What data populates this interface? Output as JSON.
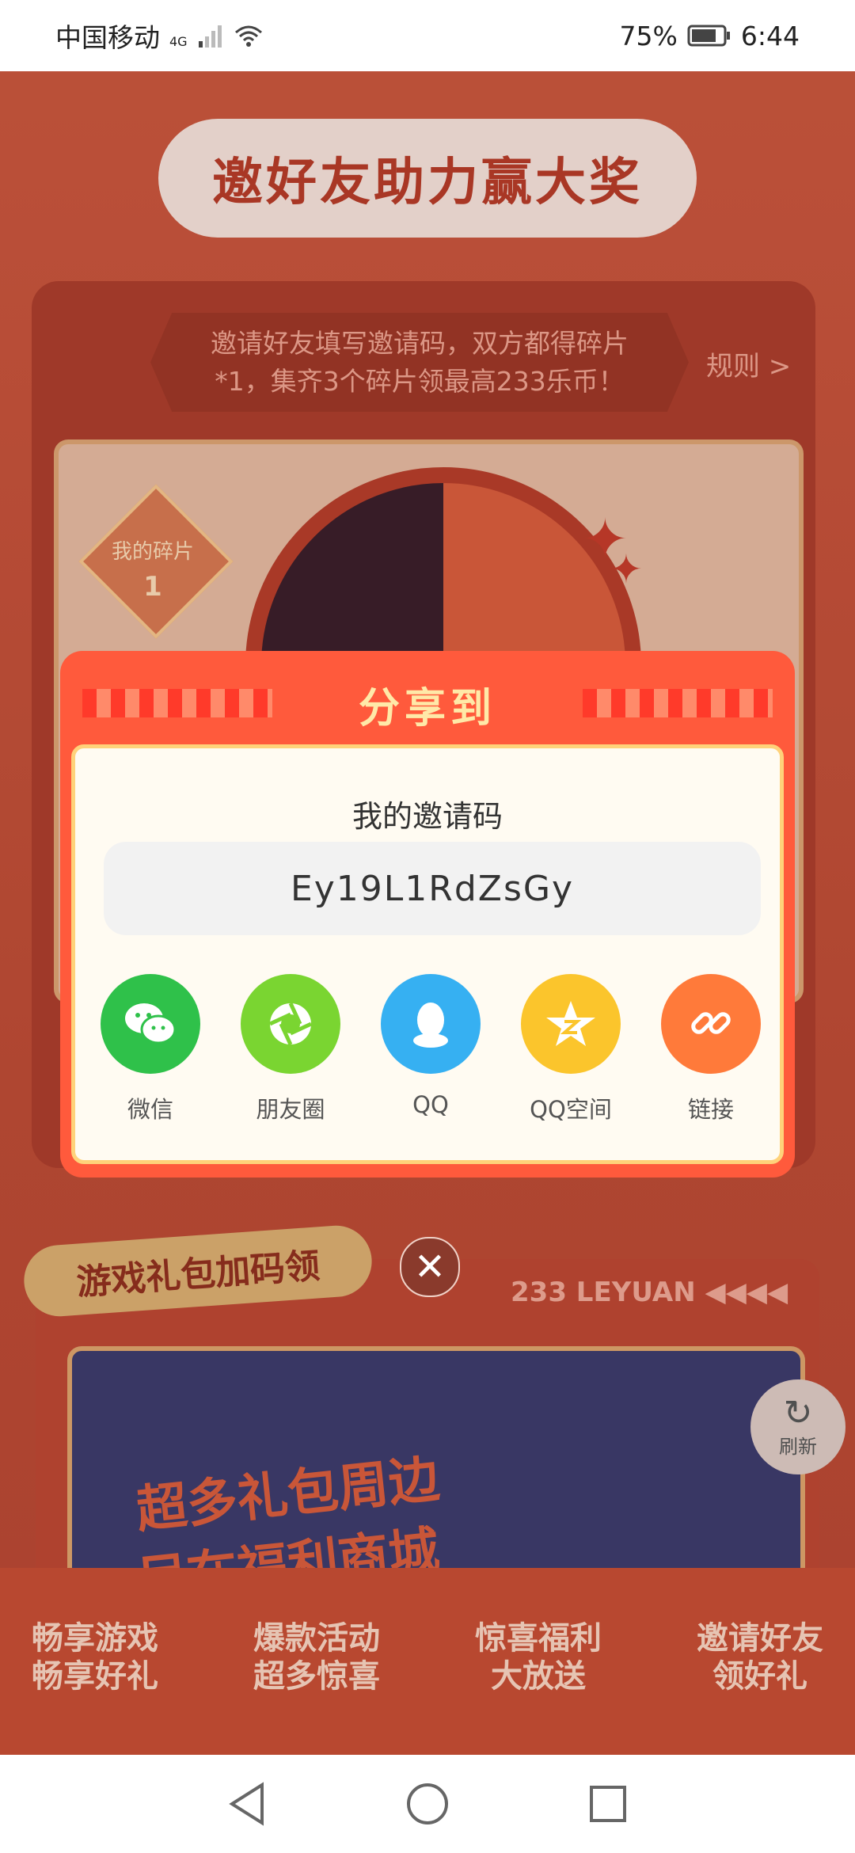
{
  "status_bar": {
    "carrier": "中国移动",
    "network": "4G",
    "battery": "75%",
    "time": "6:44"
  },
  "page": {
    "title": "邀好友助力赢大奖",
    "invite_text_line1": "邀请好友填写邀请码，双方都得碎片",
    "invite_text_line2": "*1，集齐3个碎片领最高233乐币！",
    "rules_label": "规则 >",
    "my_fragments_label": "我的碎片",
    "my_fragments_count": "1",
    "gift_tag": "游戏礼包加码领",
    "leyuan_label": "233 LEYUAN",
    "banner_line1": "超多礼包周边",
    "banner_line2": "尽在福利商城",
    "refresh_label": "刷新",
    "features": [
      {
        "line1": "畅享游戏",
        "line2": "畅享好礼"
      },
      {
        "line1": "爆款活动",
        "line2": "超多惊喜"
      },
      {
        "line1": "惊喜福利",
        "line2": "大放送"
      },
      {
        "line1": "邀请好友",
        "line2": "领好礼"
      }
    ]
  },
  "share_modal": {
    "title": "分享到",
    "code_label": "我的邀请码",
    "invite_code": "Ey19L1RdZsGy",
    "options": [
      {
        "label": "微信",
        "icon": "wechat-icon",
        "color": "#2fc14a"
      },
      {
        "label": "朋友圈",
        "icon": "moments-icon",
        "color": "#7ad531"
      },
      {
        "label": "QQ",
        "icon": "qq-icon",
        "color": "#36b0f2"
      },
      {
        "label": "QQ空间",
        "icon": "qzone-icon",
        "color": "#fbc52c"
      },
      {
        "label": "链接",
        "icon": "link-icon",
        "color": "#ff7a3a"
      }
    ]
  }
}
